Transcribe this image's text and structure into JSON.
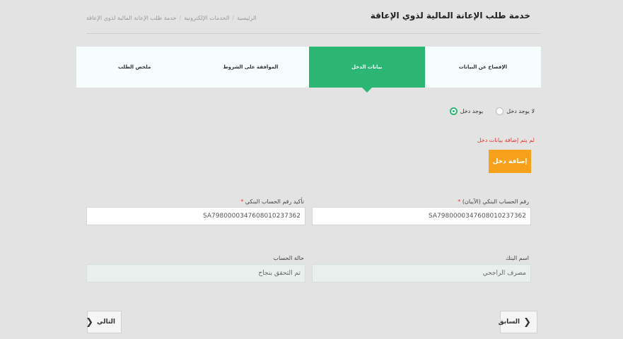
{
  "header": {
    "title": "خدمة طلب الإعانة المالية لذوي الإعاقة",
    "breadcrumb": [
      "الرئيسية",
      "الخدمات الإلكترونية",
      "خدمة طلب الإعانة المالية لذوي الإعاقة"
    ],
    "breadcrumb_separator": "/"
  },
  "steps": [
    {
      "label": "الإفصاح عن البيانات",
      "active": false
    },
    {
      "label": "بيانات الدخل",
      "active": true
    },
    {
      "label": "الموافقة على الشروط",
      "active": false
    },
    {
      "label": "ملخص الطلب",
      "active": false
    }
  ],
  "income": {
    "has_income_label": "يوجد دخل",
    "no_income_label": "لا يوجد دخل",
    "selected": "has_income",
    "error": "لم يتم إضافة بيانات دخل",
    "add_button": "إضافة دخل"
  },
  "bank": {
    "iban_label": "رقم الحساب البنكي (الآيبان)",
    "iban_value": "SA7980000347608010237362",
    "confirm_label": "تأكيد رقم الحساب البنكي",
    "confirm_value": "SA7980000347608010237362",
    "bank_name_label": "اسم البنك",
    "bank_name_value": "مصرف الراجحي",
    "status_label": "حالة الحساب",
    "status_value": "تم التحقق بنجاح",
    "required_mark": "*"
  },
  "nav": {
    "prev_label": "السابق",
    "next_label": "التالي"
  },
  "colors": {
    "accent_green": "#2bb673",
    "button_orange": "#f7a11a",
    "error_red": "#e53935"
  }
}
